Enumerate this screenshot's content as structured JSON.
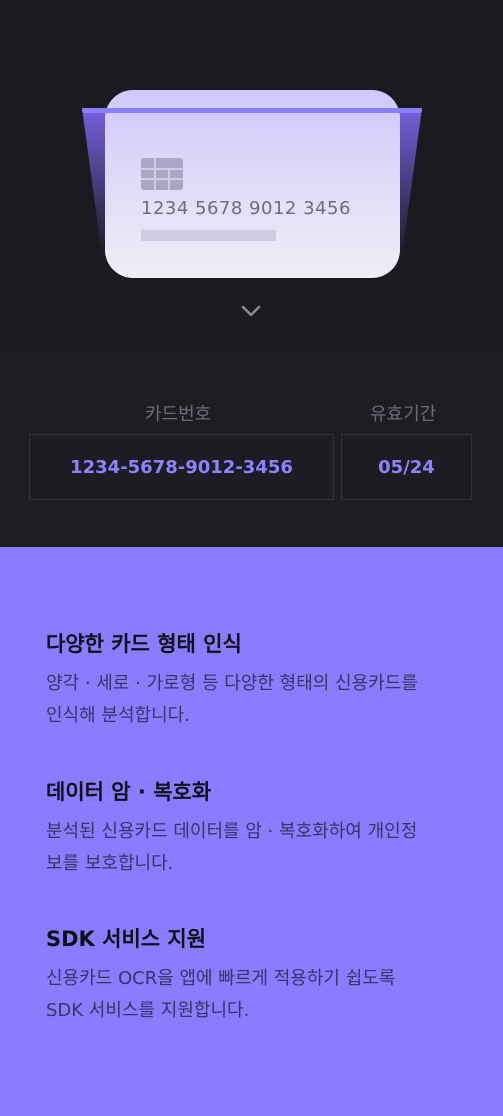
{
  "scanner": {
    "card_number_sample": "1234 5678 9012 3456",
    "accent_color": "#8b7bff"
  },
  "result": {
    "card_number_label": "카드번호",
    "expiry_label": "유효기간",
    "card_number_value": "1234-5678-9012-3456",
    "expiry_value": "05/24"
  },
  "features": [
    {
      "title": "다양한 카드 형태 인식",
      "line1": "양각 · 세로 · 가로형 등 다양한 형태의 신용카드를",
      "line2": "인식해 분석합니다."
    },
    {
      "title": "데이터 암 · 복호화",
      "line1": "분석된 신용카드 데이터를 암 · 복호화하여 개인정",
      "line2": "보를 보호합니다."
    },
    {
      "title": "SDK 서비스 지원",
      "line1": "신용카드 OCR을 앱에 빠르게 적용하기 쉽도록",
      "line2": "SDK 서비스를 지원합니다."
    }
  ]
}
